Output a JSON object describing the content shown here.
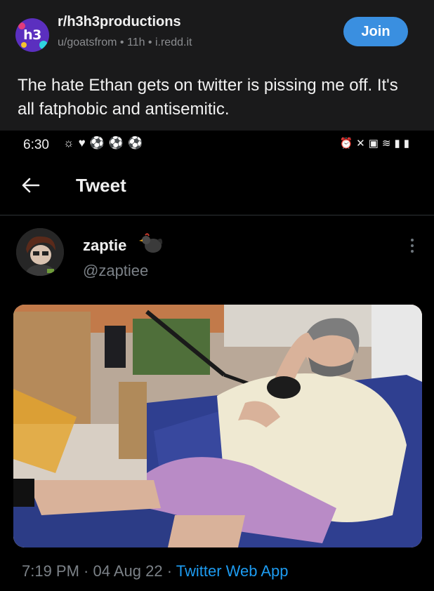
{
  "reddit": {
    "subreddit": "r/h3h3productions",
    "subreddit_logo": "h3",
    "meta": "u/goatsfrom • 11h • i.redd.it",
    "join_label": "Join",
    "title": "The hate Ethan gets on twitter is pissing me off. It's all fatphobic and antisemitic."
  },
  "status_bar": {
    "time": "6:30",
    "left_icons": [
      "weather-icon",
      "heart-icon",
      "ball-icon",
      "ball-icon",
      "ball-icon"
    ],
    "right_icons": [
      "alarm-icon",
      "mute-icon",
      "lock-icon",
      "wifi-icon",
      "signal-icon",
      "battery-icon"
    ]
  },
  "twitter": {
    "header_title": "Tweet",
    "display_name": "zaptie",
    "handle": "@zaptiee",
    "timestamp": "7:19 PM · 04 Aug 22 · ",
    "app": "Twitter Web App"
  },
  "colors": {
    "reddit_bg": "#1a1a1b",
    "join_blue": "#3a8fe0",
    "twitter_blue": "#1d9bf0",
    "muted": "#7b8187"
  }
}
